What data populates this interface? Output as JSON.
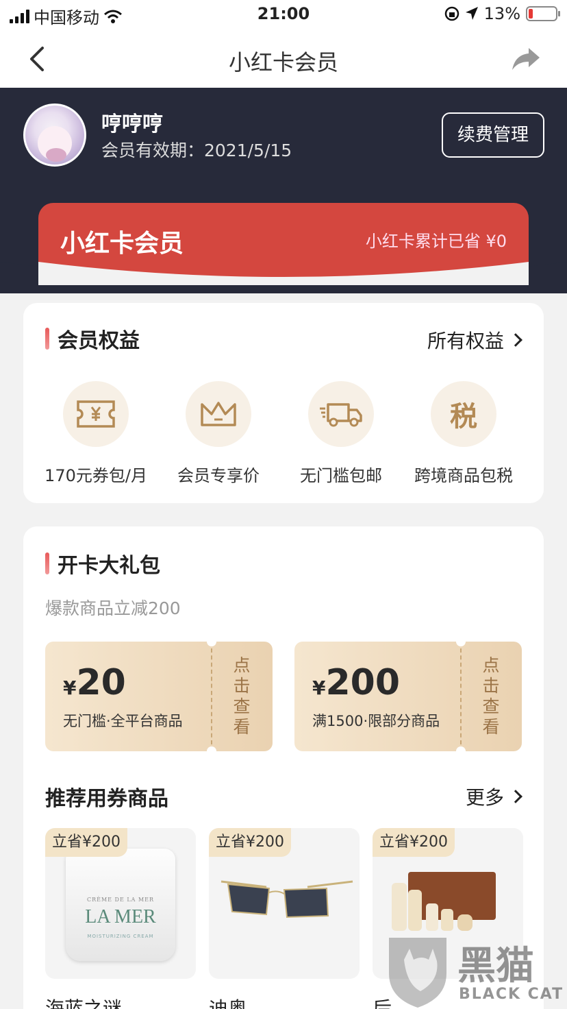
{
  "status": {
    "carrier": "中国移动",
    "time": "21:00",
    "battery": "13%"
  },
  "nav": {
    "title": "小红卡会员"
  },
  "profile": {
    "name": "哼哼哼",
    "validity": "会员有效期：2021/5/15",
    "renew_label": "续费管理"
  },
  "member_card": {
    "title": "小红卡会员",
    "saved": "小红卡累计已省 ¥0"
  },
  "benefits": {
    "title": "会员权益",
    "more": "所有权益",
    "items": [
      {
        "label": "170元券包/月",
        "icon": "ticket-yen-icon"
      },
      {
        "label": "会员专享价",
        "icon": "crown-icon"
      },
      {
        "label": "无门槛包邮",
        "icon": "truck-icon"
      },
      {
        "label": "跨境商品包税",
        "icon": "tax-icon",
        "glyph": "税"
      }
    ]
  },
  "gift": {
    "title": "开卡大礼包",
    "subtitle": "爆款商品立减200",
    "coupons": [
      {
        "symbol": "¥",
        "amount": "20",
        "desc": "无门槛·全平台商品",
        "cta": [
          "点",
          "击",
          "查",
          "看"
        ]
      },
      {
        "symbol": "¥",
        "amount": "200",
        "desc": "满1500·限部分商品",
        "cta": [
          "点",
          "击",
          "查",
          "看"
        ]
      }
    ],
    "rec_title": "推荐用券商品",
    "rec_more": "更多",
    "products": [
      {
        "badge": "立省¥200",
        "name": "海蓝之谜",
        "brand_text": "LA MER",
        "brand_top": "CRÈME DE LA MER",
        "brand_sub": "MOISTURIZING CREAM"
      },
      {
        "badge": "立省¥200",
        "name": "迪奥"
      },
      {
        "badge": "立省¥200",
        "name": "后"
      }
    ]
  },
  "watermark": {
    "text": "黑猫",
    "sub": "BLACK CAT"
  }
}
